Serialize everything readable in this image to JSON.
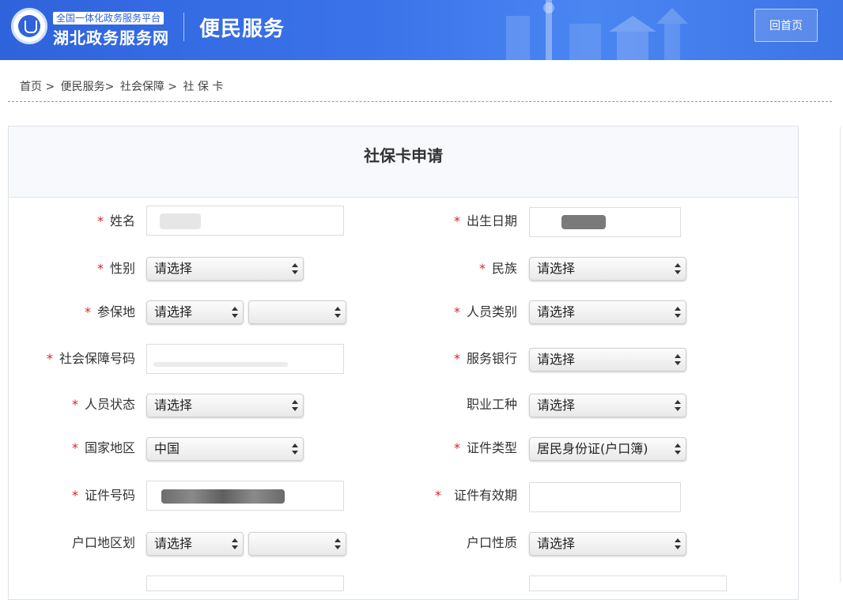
{
  "header": {
    "site_subtitle": "全国一体化政务服务平台",
    "site_name": "湖北政务服务网",
    "section_title": "便民服务",
    "home_button": "回首页"
  },
  "breadcrumb": [
    "首页 >",
    "便民服务>",
    "社会保障 >",
    "社 保 卡"
  ],
  "form": {
    "title": "社保卡申请",
    "required_mark": "*",
    "fields": {
      "name": "姓名",
      "birth_date": "出生日期",
      "gender": "性别",
      "ethnicity": "民族",
      "insured_place": "参保地",
      "person_category": "人员类别",
      "social_security_no": "社会保障号码",
      "service_bank": "服务银行",
      "person_status": "人员状态",
      "occupation": "职业工种",
      "country_region": "国家地区",
      "id_type": "证件类型",
      "id_number": "证件号码",
      "id_validity": "证件有效期",
      "household_region": "户口地区划",
      "household_type": "户口性质"
    },
    "values": {
      "placeholder": "请选择",
      "country": "中国",
      "id_type": "居民身份证(户口簿)",
      "empty": ""
    }
  },
  "colors": {
    "header_blue": "#2f63dc",
    "required_red": "#e02020"
  },
  "icons": {
    "logo": "emblem-icon",
    "select_arrows": "updown-arrows-icon"
  }
}
